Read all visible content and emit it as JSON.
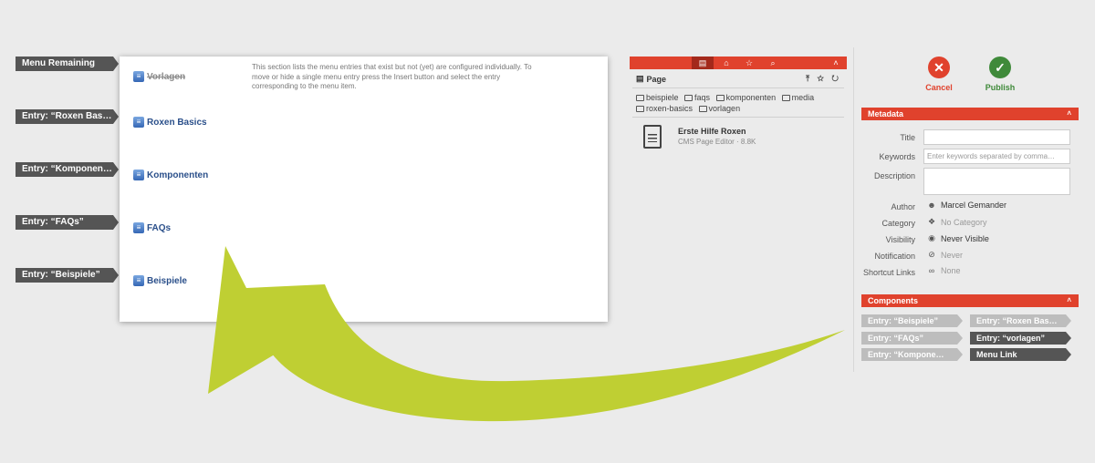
{
  "tags": [
    {
      "label": "Menu Remaining"
    },
    {
      "label": "Entry: “Roxen Bas…"
    },
    {
      "label": "Entry: “Komponen…"
    },
    {
      "label": "Entry: “FAQs”"
    },
    {
      "label": "Entry: “Beispiele”"
    }
  ],
  "menu_panel": {
    "help_text": "This section lists the menu entries that exist but not (yet) are configured individually. To move or hide a single menu entry press the Insert button and select the entry corresponding to the menu item.",
    "items": [
      {
        "label": "Vorlagen",
        "icon": "menu-entry-icon",
        "strike": true
      },
      {
        "label": "Roxen Basics",
        "icon": "menu-entry-icon"
      },
      {
        "label": "Komponenten",
        "icon": "menu-entry-icon"
      },
      {
        "label": "FAQs",
        "icon": "menu-entry-icon"
      },
      {
        "label": "Beispiele",
        "icon": "menu-entry-icon"
      }
    ]
  },
  "file_browser": {
    "toolbar": {
      "buttons": [
        "page-icon",
        "home-icon",
        "star-icon",
        "search-icon",
        "chevron-up-icon"
      ],
      "active": "page-icon",
      "glyphs": {
        "page": "▤",
        "home": "⌂",
        "star": "☆",
        "search": "⌕",
        "chevron": "˄"
      }
    },
    "header": {
      "title": "Page",
      "tools": "⤒ ☆ ↻"
    },
    "folders": [
      "beispiele",
      "faqs",
      "komponenten",
      "media",
      "roxen-basics",
      "vorlagen"
    ],
    "file": {
      "name": "Erste Hilfe Roxen",
      "meta": "CMS Page Editor · 8.8K"
    }
  },
  "actions": {
    "cancel": {
      "label": "Cancel",
      "glyph": "✕",
      "color": "#e0422d"
    },
    "publish": {
      "label": "Publish",
      "glyph": "✓",
      "color": "#3f8a3a"
    }
  },
  "metadata": {
    "title": "Metadata",
    "chevron": "˄",
    "fields": {
      "title_label": "Title",
      "keywords_label": "Keywords",
      "keywords_placeholder": "Enter keywords separated by comma…",
      "description_label": "Description"
    },
    "rows": [
      {
        "label": "Author",
        "value": "Marcel Gemander",
        "icon": "user-icon",
        "glyph": "☻"
      },
      {
        "label": "Category",
        "value": "No Category",
        "icon": "tag-icon",
        "glyph": "❖"
      },
      {
        "label": "Visibility",
        "value": "Never Visible",
        "icon": "eye-slash-icon",
        "glyph": "◉"
      },
      {
        "label": "Notification",
        "value": "Never",
        "icon": "bell-slash-icon",
        "glyph": "⊘"
      },
      {
        "label": "Shortcut Links",
        "value": "None",
        "icon": "link-icon",
        "glyph": "∞"
      }
    ]
  },
  "components": {
    "title": "Components",
    "chevron": "˄",
    "items": [
      {
        "label": "Entry: “Beispiele”",
        "style": "light"
      },
      {
        "label": "Entry: “Roxen Bas…",
        "style": "light"
      },
      {
        "label": "Entry: “FAQs”",
        "style": "light"
      },
      {
        "label": "Entry: “vorlagen”",
        "style": "dark"
      },
      {
        "label": "Entry: “Kompone…",
        "style": "light"
      },
      {
        "label": "Menu Link",
        "style": "dark"
      }
    ]
  },
  "colors": {
    "accent": "#e0422d",
    "arrow": "#bfcf33",
    "tag": "#555555"
  }
}
